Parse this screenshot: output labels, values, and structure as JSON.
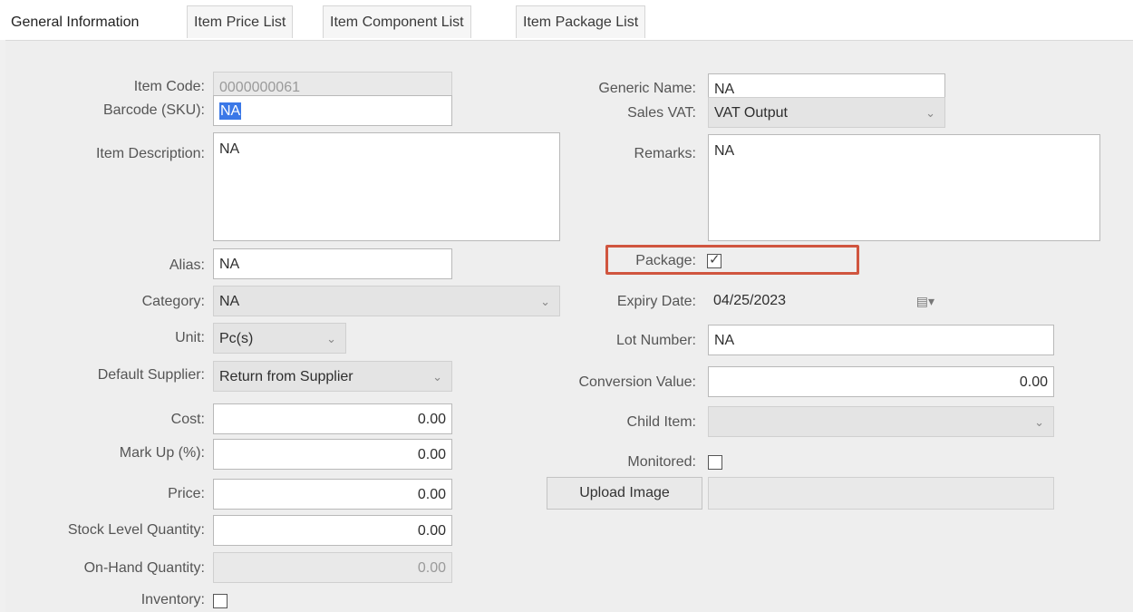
{
  "tabs": [
    "General Information",
    "Item Price List",
    "Item Component List",
    "Item Package List"
  ],
  "left": {
    "item_code": {
      "label": "Item Code:",
      "value": "0000000061"
    },
    "barcode": {
      "label": "Barcode (SKU):",
      "value": "NA"
    },
    "description": {
      "label": "Item Description:",
      "value": "NA"
    },
    "alias": {
      "label": "Alias:",
      "value": "NA"
    },
    "category": {
      "label": "Category:",
      "value": "NA"
    },
    "unit": {
      "label": "Unit:",
      "value": "Pc(s)"
    },
    "default_supplier": {
      "label": "Default Supplier:",
      "value": "Return from Supplier"
    },
    "cost": {
      "label": "Cost:",
      "value": "0.00"
    },
    "markup": {
      "label": "Mark Up (%):",
      "value": "0.00"
    },
    "price": {
      "label": "Price:",
      "value": "0.00"
    },
    "stock_level": {
      "label": "Stock Level Quantity:",
      "value": "0.00"
    },
    "on_hand": {
      "label": "On-Hand Quantity:",
      "value": "0.00"
    },
    "inventory": {
      "label": "Inventory:",
      "checked": false
    }
  },
  "right": {
    "generic_name": {
      "label": "Generic Name:",
      "value": "NA"
    },
    "sales_vat": {
      "label": "Sales VAT:",
      "value": "VAT Output"
    },
    "remarks": {
      "label": "Remarks:",
      "value": "NA"
    },
    "package": {
      "label": "Package:",
      "checked": true
    },
    "expiry_date": {
      "label": "Expiry Date:",
      "value": "04/25/2023"
    },
    "lot_number": {
      "label": "Lot Number:",
      "value": "NA"
    },
    "conversion_value": {
      "label": "Conversion Value:",
      "value": "0.00"
    },
    "child_item": {
      "label": "Child Item:",
      "value": ""
    },
    "monitored": {
      "label": "Monitored:",
      "checked": false
    },
    "upload_image": {
      "label": "Upload Image",
      "path": ""
    }
  },
  "colors": {
    "highlight": "#d0553f",
    "selection": "#3b78e7"
  }
}
